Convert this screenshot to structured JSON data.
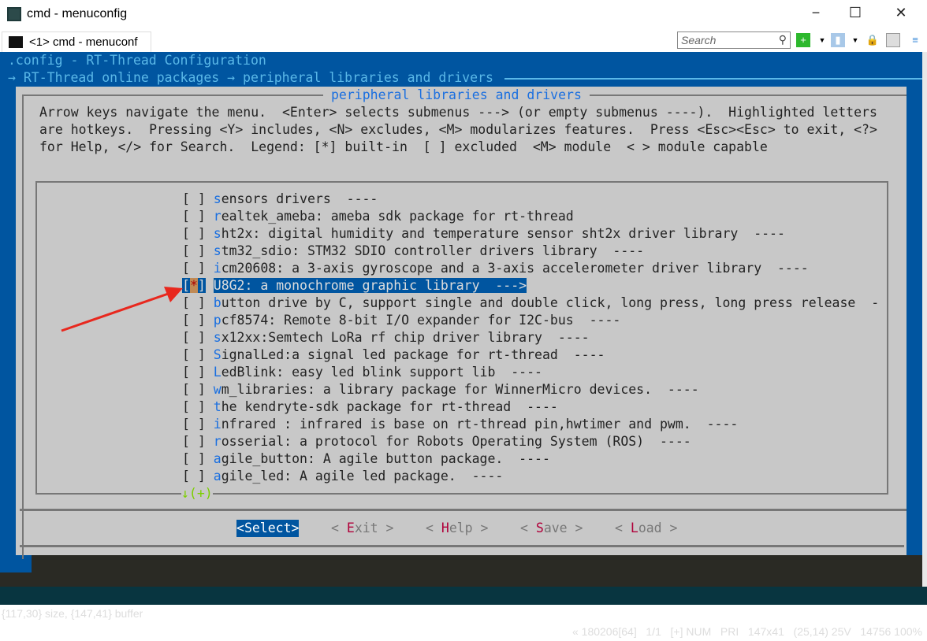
{
  "window": {
    "title": "cmd - menuconfig",
    "min": "−",
    "max": "☐",
    "close": "✕"
  },
  "tab": {
    "label": "<1> cmd - menuconf"
  },
  "toolbar": {
    "search_placeholder": "Search"
  },
  "terminal": {
    "config_title": ".config - RT-Thread Configuration",
    "breadcrumb": "→ RT-Thread online packages → peripheral libraries and drivers",
    "dialog_title": "peripheral libraries and drivers",
    "help": [
      "Arrow keys navigate the menu.  <Enter> selects submenus ---> (or empty submenus ----).  Highlighted letters",
      "are hotkeys.  Pressing <Y> includes, <N> excludes, <M> modularizes features.  Press <Esc><Esc> to exit, <?>",
      "for Help, </> for Search.  Legend: [*] built-in  [ ] excluded  <M> module  < > module capable"
    ],
    "items": [
      {
        "check": " ",
        "hot": "s",
        "rest": "ensors drivers  ----"
      },
      {
        "check": " ",
        "hot": "r",
        "rest": "ealtek_ameba: ameba sdk package for rt-thread"
      },
      {
        "check": " ",
        "hot": "s",
        "rest": "ht2x: digital humidity and temperature sensor sht2x driver library  ----"
      },
      {
        "check": " ",
        "hot": "s",
        "rest": "tm32_sdio: STM32 SDIO controller drivers library  ----"
      },
      {
        "check": " ",
        "hot": "i",
        "rest": "cm20608: a 3-axis gyroscope and a 3-axis accelerometer driver library  ----"
      },
      {
        "check": "*",
        "hot": "U",
        "rest": "8G2: a monochrome graphic library  --->",
        "selected": true
      },
      {
        "check": " ",
        "hot": "b",
        "rest": "utton drive by C, support single and double click, long press, long press release  -"
      },
      {
        "check": " ",
        "hot": "p",
        "rest": "cf8574: Remote 8-bit I/O expander for I2C-bus  ----"
      },
      {
        "check": " ",
        "hot": "s",
        "rest": "x12xx:Semtech LoRa rf chip driver library  ----"
      },
      {
        "check": " ",
        "hot": "S",
        "rest": "ignalLed:a signal led package for rt-thread  ----"
      },
      {
        "check": " ",
        "hot": "L",
        "rest": "edBlink: easy led blink support lib  ----"
      },
      {
        "check": " ",
        "hot": "w",
        "rest": "m_libraries: a library package for WinnerMicro devices.  ----"
      },
      {
        "check": " ",
        "hot": "t",
        "rest": "he kendryte-sdk package for rt-thread  ----"
      },
      {
        "check": " ",
        "hot": "i",
        "rest": "nfrared : infrared is base on rt-thread pin,hwtimer and pwm.  ----"
      },
      {
        "check": " ",
        "hot": "r",
        "rest": "osserial: a protocol for Robots Operating System (ROS)  ----"
      },
      {
        "check": " ",
        "hot": "a",
        "rest": "gile_button: A agile button package.  ----"
      },
      {
        "check": " ",
        "hot": "a",
        "rest": "gile_led: A agile led package.  ----"
      }
    ],
    "more": "↓(+)",
    "buttons": [
      {
        "pre": "<",
        "key": "",
        "rest": "Select",
        "post": ">",
        "selected": true
      },
      {
        "pre": "< ",
        "key": "E",
        "rest": "xit",
        "post": " >"
      },
      {
        "pre": "< ",
        "key": "H",
        "rest": "elp",
        "post": " >"
      },
      {
        "pre": "< ",
        "key": "S",
        "rest": "ave",
        "post": " >"
      },
      {
        "pre": "< ",
        "key": "L",
        "rest": "oad",
        "post": " >"
      }
    ]
  },
  "statusbar": {
    "left": "{117,30} size, {147,41} buffer",
    "right": "« 180206[64]   1/1   [+] NUM   PRI   147x41   (25,14) 25V   14756 100%"
  }
}
